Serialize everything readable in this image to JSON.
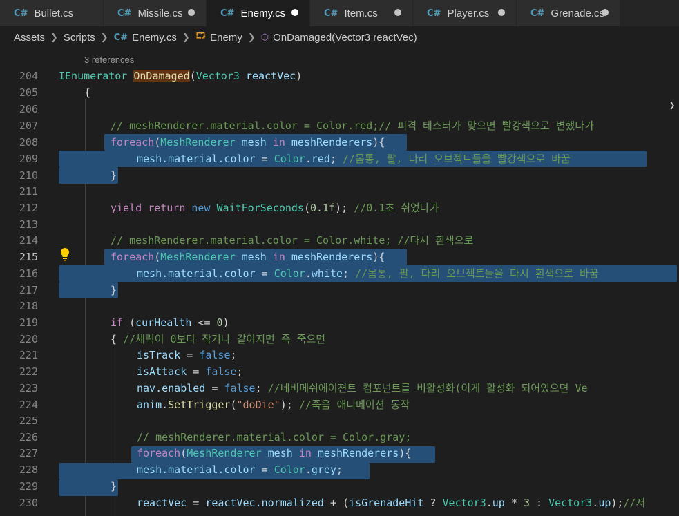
{
  "tabs": [
    {
      "label": "Bullet.cs",
      "modified": false,
      "active": false
    },
    {
      "label": "Missile.cs",
      "modified": true,
      "active": false
    },
    {
      "label": "Enemy.cs",
      "modified": true,
      "active": true
    },
    {
      "label": "Item.cs",
      "modified": true,
      "active": false
    },
    {
      "label": "Player.cs",
      "modified": true,
      "active": false
    },
    {
      "label": "Grenade.cs",
      "modified": true,
      "active": false
    }
  ],
  "breadcrumb": {
    "assets": "Assets",
    "scripts": "Scripts",
    "file": "Enemy.cs",
    "class": "Enemy",
    "method": "OnDamaged(Vector3 reactVec)"
  },
  "codelens": "3 references",
  "line_numbers": [
    "204",
    "205",
    "206",
    "207",
    "208",
    "209",
    "210",
    "211",
    "212",
    "213",
    "214",
    "215",
    "216",
    "217",
    "218",
    "219",
    "220",
    "221",
    "222",
    "223",
    "224",
    "225",
    "226",
    "227",
    "228",
    "229",
    "230"
  ],
  "current_line": "215",
  "code": {
    "l204_type": "IEnumerator",
    "l204_fn": "OnDamaged",
    "l204_param_type": "Vector3",
    "l204_param": "reactVec",
    "l207": "// meshRenderer.material.color = Color.red;// 피격 테스터가 맞으면 빨강색으로 변했다가",
    "foreach": "foreach",
    "meshrenderer": "MeshRenderer",
    "mesh": "mesh",
    "in": "in",
    "meshrenderers": "meshRenderers",
    "mesh_material_color": "mesh.material.color",
    "color": "Color",
    "l209_val": "red",
    "l209_cm": "//몸통, 팔, 다리 오브젝트들을 빨강색으로 바꿈",
    "l212_yield": "yield",
    "l212_return": "return",
    "l212_new": "new",
    "l212_type": "WaitForSeconds",
    "l212_num": "0.1f",
    "l212_cm": "//0.1초 쉬었다가",
    "l214": "// meshRenderer.material.color = Color.white; //다시 흰색으로",
    "l216_val": "white",
    "l216_cm": "//몸통, 팔, 다리 오브젝트들을 다시 흰색으로 바꿈",
    "l219_if": "if",
    "l219_var": "curHealth",
    "l219_num": "0",
    "l220_cm": "//체력이 0보다 작거나 같아지면 즉 죽으면",
    "l221_var": "isTrack",
    "l222_var": "isAttack",
    "false": "false",
    "l223_var": "nav.enabled",
    "l223_cm": "//네비메쉬에이젼트 컴포넌트를 비활성화(이게 활성화 되어있으면 Ve",
    "l224_var": "anim",
    "l224_fn": "SetTrigger",
    "l224_str": "\"doDie\"",
    "l224_cm": "//죽음 애니메이션 동작",
    "l226": "// meshRenderer.material.color = Color.gray;",
    "l228_val": "grey",
    "l230_a": "reactVec",
    "l230_b": "reactVec.normalized",
    "l230_c": "isGrenadeHit",
    "l230_type": "Vector3",
    "l230_up": "up",
    "l230_num": "3",
    "l230_cm": "//저"
  },
  "colors": {
    "selection": "#264f78",
    "keyword": "#569cd6",
    "control": "#c586c0",
    "type": "#4ec9b0",
    "comment": "#6a9955"
  }
}
